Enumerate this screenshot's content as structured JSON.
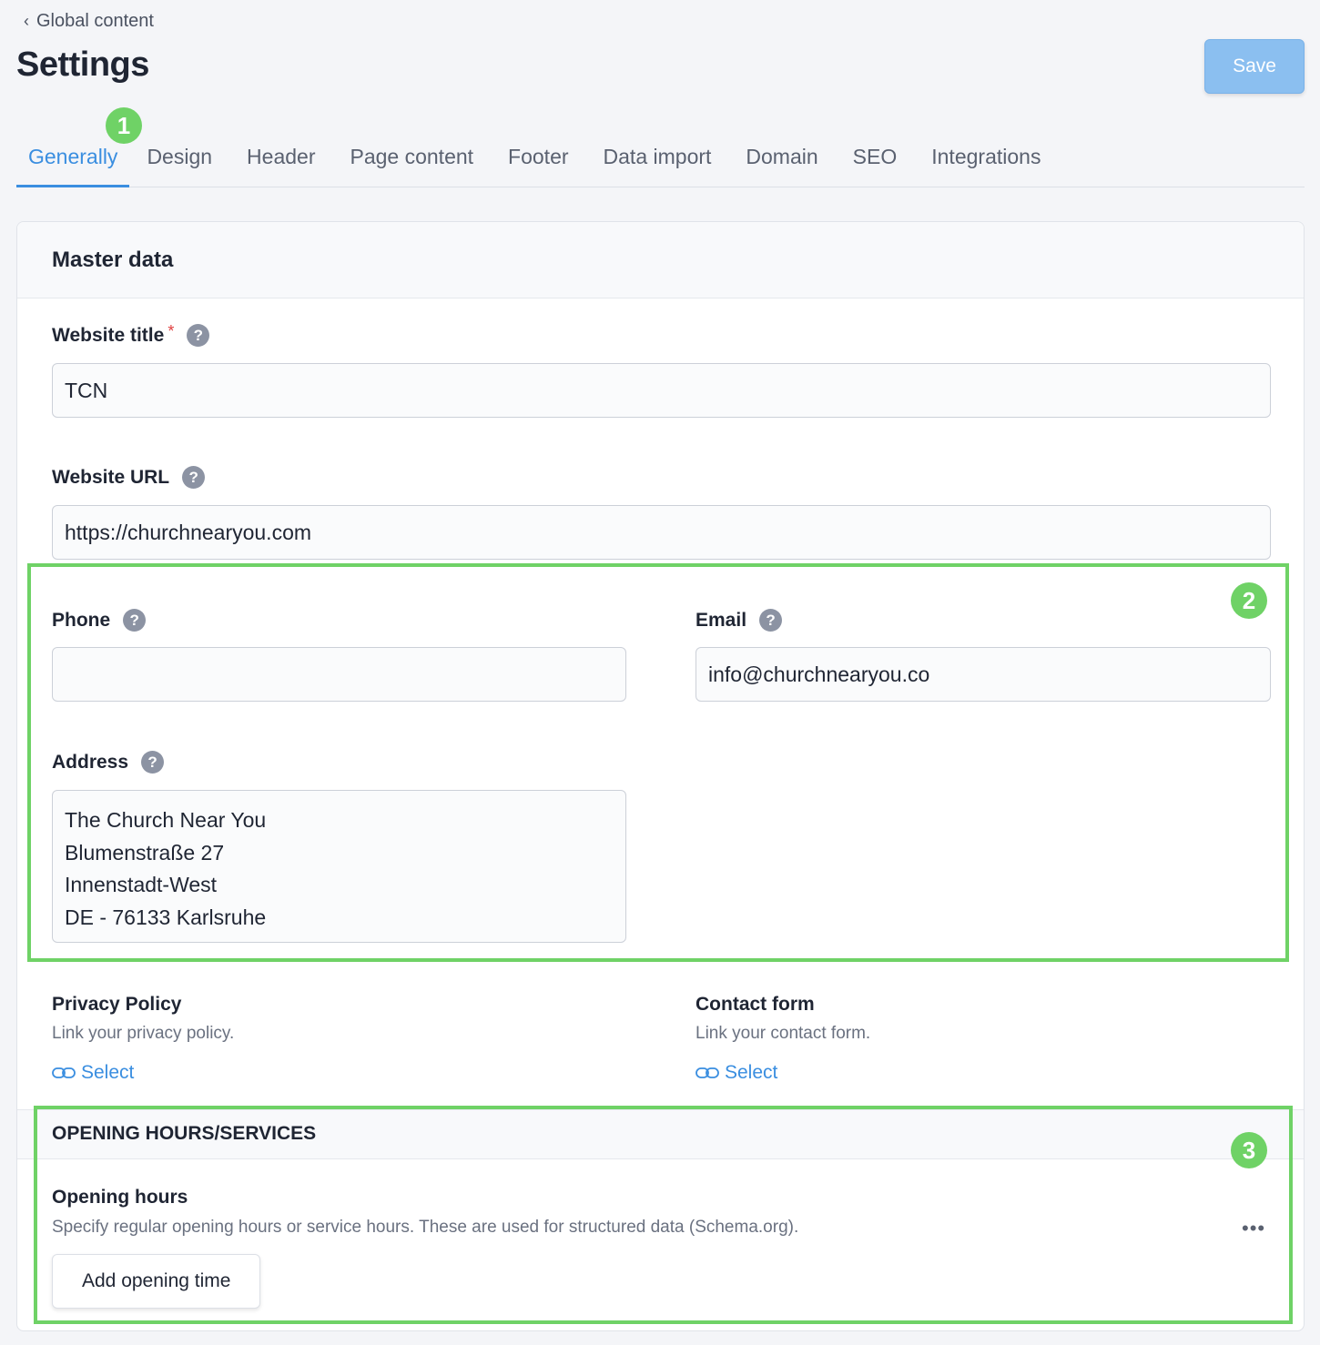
{
  "nav": {
    "back_label": "Global content",
    "page_title": "Settings",
    "save_label": "Save"
  },
  "tabs": [
    {
      "label": "Generally",
      "active": true
    },
    {
      "label": "Design",
      "active": false
    },
    {
      "label": "Header",
      "active": false
    },
    {
      "label": "Page content",
      "active": false
    },
    {
      "label": "Footer",
      "active": false
    },
    {
      "label": "Data import",
      "active": false
    },
    {
      "label": "Domain",
      "active": false
    },
    {
      "label": "SEO",
      "active": false
    },
    {
      "label": "Integrations",
      "active": false
    }
  ],
  "markers": [
    "1",
    "2",
    "3"
  ],
  "master": {
    "title": "Master data",
    "website_title": {
      "label": "Website title",
      "required": "*",
      "value": "TCN"
    },
    "website_url": {
      "label": "Website URL",
      "value": "https://churchnearyou.com"
    },
    "phone": {
      "label": "Phone",
      "value": ""
    },
    "email": {
      "label": "Email",
      "value": "info@churchnearyou.co"
    },
    "address": {
      "label": "Address",
      "lines": [
        "The Church Near You",
        "Blumenstraße 27",
        "Innenstadt-West",
        "DE - 76133 Karlsruhe"
      ]
    },
    "privacy": {
      "label": "Privacy Policy",
      "desc": "Link your privacy policy.",
      "link": "Select"
    },
    "contact": {
      "label": "Contact form",
      "desc": "Link your contact form.",
      "link": "Select"
    }
  },
  "hours": {
    "section_title": "OPENING HOURS/SERVICES",
    "label": "Opening hours",
    "desc": "Specify regular opening hours or service hours. These are used for structured data (Schema.org).",
    "more": "•••",
    "add_label": "Add opening time"
  },
  "icons": {
    "back": "chevron-left-icon",
    "help": "question-circle-icon",
    "link": "link-icon",
    "more": "more-dots-icon"
  },
  "colors": {
    "accent": "#3a8ee0",
    "save_button": "#8bbff0",
    "highlight": "#6fd266",
    "required": "#e04040"
  }
}
